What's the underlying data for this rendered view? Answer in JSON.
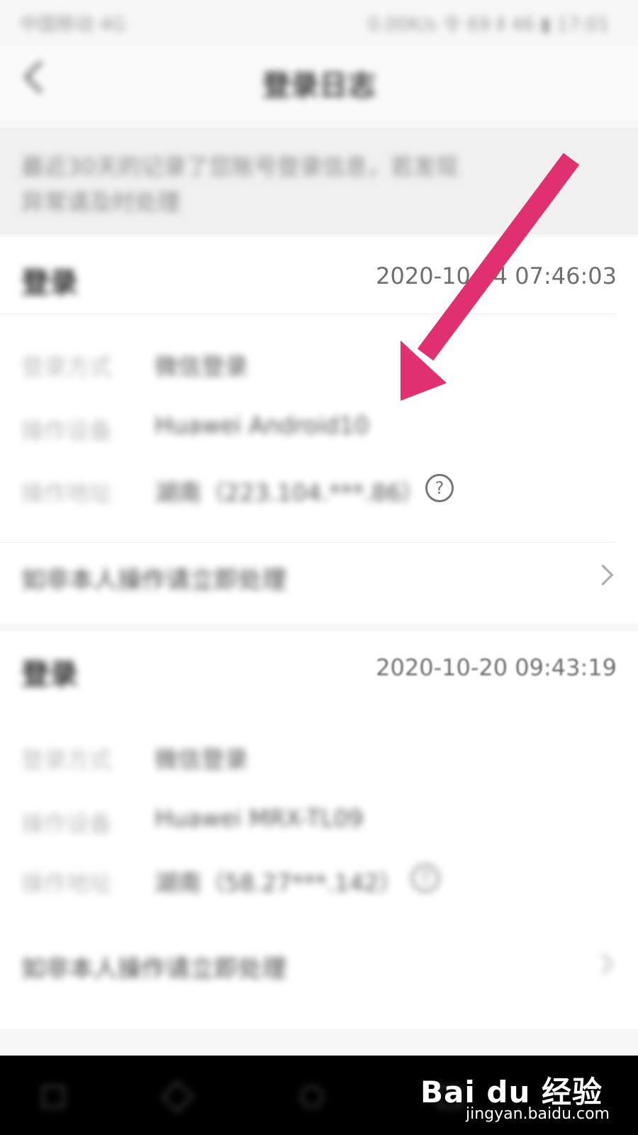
{
  "status_bar": {
    "left": "中国移动 4G",
    "right": "0.00K/s 令 69 Ⅱ 46 ▮ 17:01"
  },
  "header": {
    "title": "登录日志"
  },
  "notice": {
    "line1": "最近30天的记录了您账号登录信息，若发现",
    "line2": "异常请及时处理"
  },
  "records": [
    {
      "type": "登录",
      "time": "2020-10-04 07:46:03",
      "rows": [
        {
          "label": "登录方式",
          "value": "微信登录"
        },
        {
          "label": "操作设备",
          "value": "Huawei Android10"
        },
        {
          "label": "操作地址",
          "value": "湖南（223.104.***.86）"
        }
      ],
      "link": "如非本人操作请立即处理"
    },
    {
      "type": "登录",
      "time": "2020-10-20 09:43:19",
      "rows": [
        {
          "label": "登录方式",
          "value": "微信登录"
        },
        {
          "label": "操作设备",
          "value": "Huawei MRX-TL09"
        },
        {
          "label": "操作地址",
          "value": "湖南（58.27***.142）"
        }
      ],
      "link": "如非本人操作请立即处理"
    }
  ],
  "help_symbol": "?",
  "watermark": {
    "brand": "Bai du 经验",
    "site": "jingyan.baidu.com"
  },
  "annotation": {
    "arrow_color": "#e0306f"
  }
}
